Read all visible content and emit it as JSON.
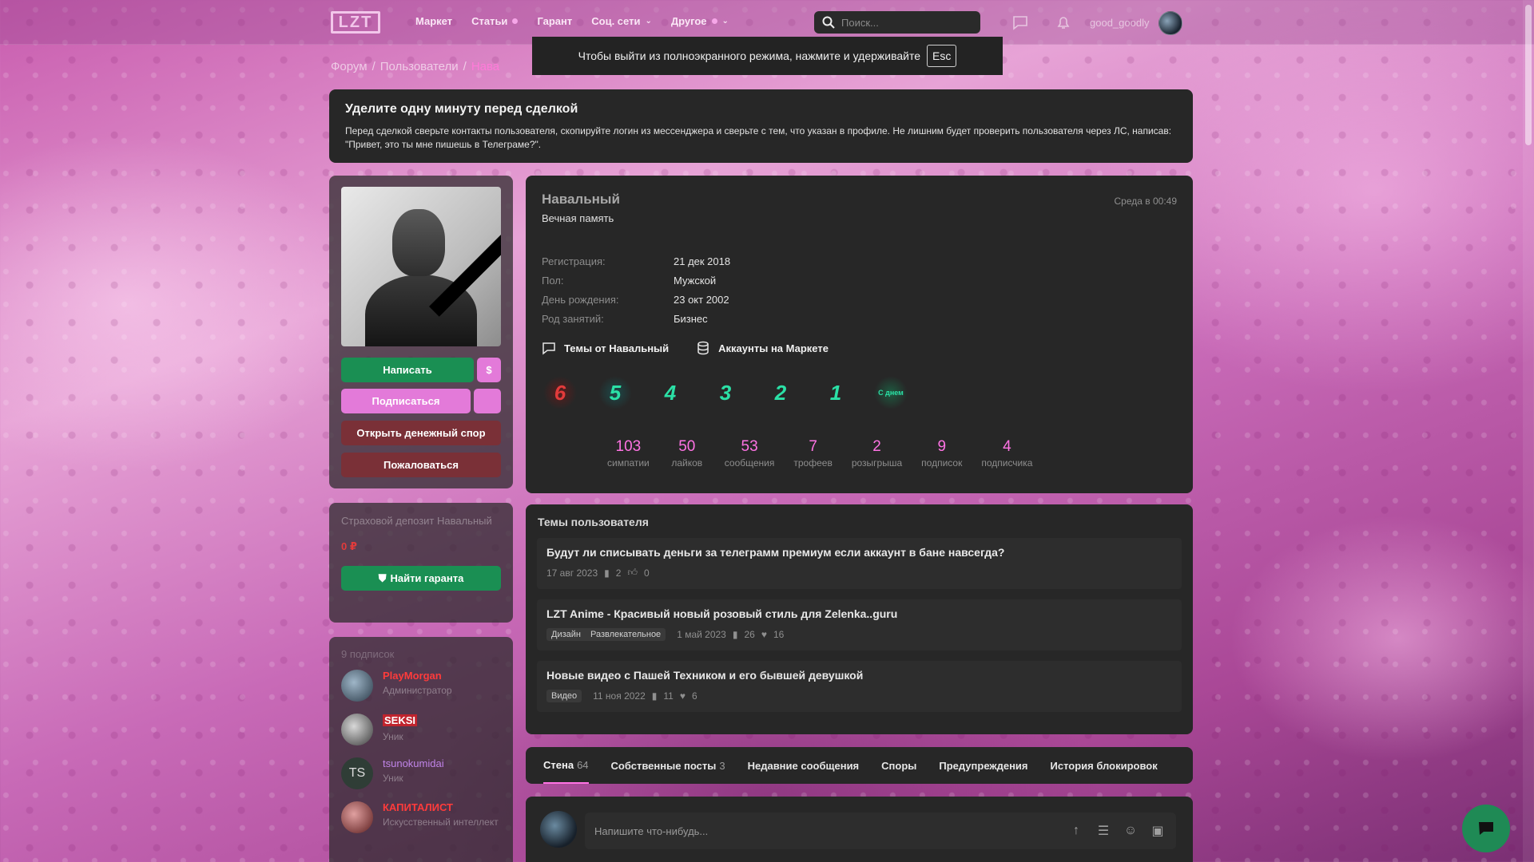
{
  "nav": {
    "logo": "LZT",
    "items": [
      {
        "label": "Маркет"
      },
      {
        "label": "Статьи"
      },
      {
        "label": "Гарант"
      },
      {
        "label": "Соц. сети"
      },
      {
        "label": "Другое"
      }
    ],
    "search_placeholder": "Поиск...",
    "username": "good_goodly"
  },
  "fullscreen_banner": {
    "text": "Чтобы выйти из полноэкранного режима, нажмите и удерживайте",
    "key": "Esc"
  },
  "breadcrumb": {
    "items": [
      "Форум",
      "Пользователи",
      "Нава"
    ]
  },
  "notice": {
    "title": "Уделите одну минуту перед сделкой",
    "text": "Перед сделкой сверьте контакты пользователя, скопируйте логин из мессенджера и сверьте с тем, что указан в профиле. Не лишним будет проверить пользователя через ЛС, написав: \"Привет, это ты мне пишешь в Телеграме?\"."
  },
  "sidebar": {
    "write_button": "Написать",
    "money_button": "$",
    "subscribe_button": "Подписаться",
    "dispute_button": "Открыть денежный спор",
    "report_button": "Пожаловаться",
    "deposit_label": "Страховой депозит Навальный",
    "deposit_amount": "0 ₽",
    "find_guarantor_button": "Найти гаранта",
    "followers_title": "9 подписок",
    "followers": [
      {
        "name": "PlayMorgan",
        "sub": "Администратор",
        "color": "#ff3b3b"
      },
      {
        "name": "SEKSI",
        "sub": "Уник",
        "color": "#ffffff"
      },
      {
        "name": "tsunokumidai",
        "sub": "Уник",
        "color": "#c084e8",
        "initials": "TS"
      },
      {
        "name": "КАПИТАЛИСТ",
        "sub": "Искусственный интеллект",
        "color": "#ff3b3b"
      }
    ]
  },
  "profile": {
    "name": "Навальный",
    "status": "Вечная память",
    "last_seen": "Среда в 00:49",
    "info": [
      {
        "key": "Регистрация:",
        "value": "21 дек 2018"
      },
      {
        "key": "Пол:",
        "value": "Мужской"
      },
      {
        "key": "День рождения:",
        "value": "23 окт 2002"
      },
      {
        "key": "Род занятий:",
        "value": "Бизнес"
      }
    ],
    "link_topics": "Темы от Навальный",
    "link_market": "Аккаунты на Маркете",
    "trophies": [
      "6",
      "5",
      "4",
      "3",
      "2",
      "1",
      "С днем"
    ],
    "stats": [
      {
        "n": "103",
        "l": "симпатии"
      },
      {
        "n": "50",
        "l": "лайков"
      },
      {
        "n": "53",
        "l": "сообщения"
      },
      {
        "n": "7",
        "l": "трофеев"
      },
      {
        "n": "2",
        "l": "розыгрыша"
      },
      {
        "n": "9",
        "l": "подписок"
      },
      {
        "n": "4",
        "l": "подписчика"
      }
    ]
  },
  "topics": {
    "title": "Темы пользователя",
    "items": [
      {
        "title": "Будут ли списывать деньги за телеграмм премиум если аккаунт в бане навсегда?",
        "tags": [],
        "date": "17 авг 2023",
        "replies": "2",
        "likes": "0"
      },
      {
        "title": "LZT Anime - Красивый новый розовый стиль для Zelenka..guru",
        "tags": [
          "Дизайн",
          "Развлекательное"
        ],
        "date": "1 май 2023",
        "replies": "26",
        "likes": "16"
      },
      {
        "title": "Новые видео с Пашей Техником и его бывшей девушкой",
        "tags": [
          "Видео"
        ],
        "date": "11 ноя 2022",
        "replies": "11",
        "likes": "6"
      }
    ]
  },
  "tabs": [
    {
      "label": "Стена",
      "count": "64"
    },
    {
      "label": "Собственные посты",
      "count": "3"
    },
    {
      "label": "Недавние сообщения",
      "count": ""
    },
    {
      "label": "Споры",
      "count": ""
    },
    {
      "label": "Предупреждения",
      "count": ""
    },
    {
      "label": "История блокировок",
      "count": ""
    }
  ],
  "composer": {
    "placeholder": "Напишите что-нибудь..."
  },
  "colors": {
    "accent": "#ff73e4",
    "green": "#1a8f53",
    "pink": "#e37ad9",
    "maroon": "#7a3037"
  }
}
